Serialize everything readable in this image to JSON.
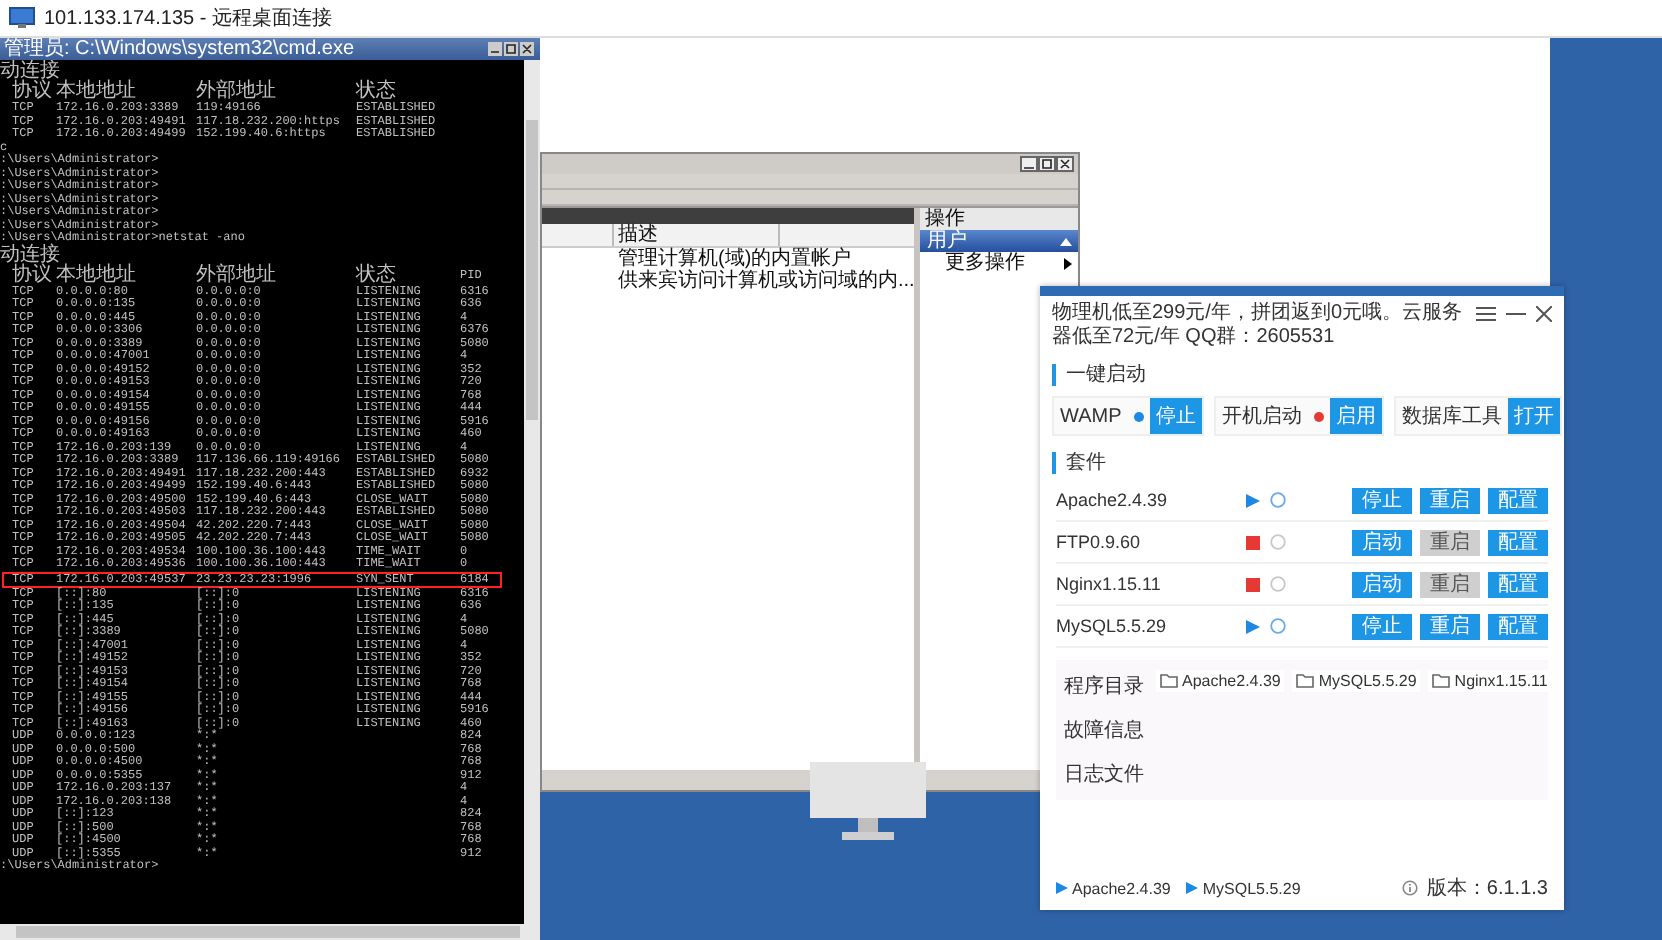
{
  "window": {
    "title": "101.133.174.135 - 远程桌面连接"
  },
  "cmd": {
    "title": "管理员: C:\\Windows\\system32\\cmd.exe",
    "lines": [
      {
        "kind": "heading",
        "text": "动连接"
      },
      {
        "kind": "header",
        "cells": [
          "协议",
          "本地地址",
          "外部地址",
          "状态"
        ]
      },
      {
        "kind": "row",
        "highlighted": false,
        "proto": "TCP",
        "local": "172.16.0.203:3389",
        "foreign": "119:49166",
        "state": "ESTABLISHED"
      },
      {
        "kind": "row",
        "highlighted": false,
        "proto": "TCP",
        "local": "172.16.0.203:49491",
        "foreign": "117.18.232.200:https",
        "state": "ESTABLISHED"
      },
      {
        "kind": "row",
        "highlighted": false,
        "proto": "TCP",
        "local": "172.16.0.203:49499",
        "foreign": "152.199.40.6:https",
        "state": "ESTABLISHED"
      },
      {
        "kind": "prompt",
        "text": "c"
      },
      {
        "kind": "prompt",
        "text": ":\\Users\\Administrator>"
      },
      {
        "kind": "prompt",
        "text": ":\\Users\\Administrator>"
      },
      {
        "kind": "prompt",
        "text": ":\\Users\\Administrator>"
      },
      {
        "kind": "prompt",
        "text": ":\\Users\\Administrator>"
      },
      {
        "kind": "prompt",
        "text": ":\\Users\\Administrator>"
      },
      {
        "kind": "prompt",
        "text": ":\\Users\\Administrator>"
      },
      {
        "kind": "prompt",
        "text": ":\\Users\\Administrator>netstat -ano"
      },
      {
        "kind": "heading",
        "text": "动连接"
      },
      {
        "kind": "header",
        "cells": [
          "协议",
          "本地地址",
          "外部地址",
          "状态",
          "PID"
        ]
      },
      {
        "kind": "row",
        "highlighted": false,
        "proto": "TCP",
        "local": "0.0.0.0:80",
        "foreign": "0.0.0.0:0",
        "state": "LISTENING",
        "pid": "6316"
      },
      {
        "kind": "row",
        "highlighted": false,
        "proto": "TCP",
        "local": "0.0.0.0:135",
        "foreign": "0.0.0.0:0",
        "state": "LISTENING",
        "pid": "636"
      },
      {
        "kind": "row",
        "highlighted": false,
        "proto": "TCP",
        "local": "0.0.0.0:445",
        "foreign": "0.0.0.0:0",
        "state": "LISTENING",
        "pid": "4"
      },
      {
        "kind": "row",
        "highlighted": false,
        "proto": "TCP",
        "local": "0.0.0.0:3306",
        "foreign": "0.0.0.0:0",
        "state": "LISTENING",
        "pid": "6376"
      },
      {
        "kind": "row",
        "highlighted": false,
        "proto": "TCP",
        "local": "0.0.0.0:3389",
        "foreign": "0.0.0.0:0",
        "state": "LISTENING",
        "pid": "5080"
      },
      {
        "kind": "row",
        "highlighted": false,
        "proto": "TCP",
        "local": "0.0.0.0:47001",
        "foreign": "0.0.0.0:0",
        "state": "LISTENING",
        "pid": "4"
      },
      {
        "kind": "row",
        "highlighted": false,
        "proto": "TCP",
        "local": "0.0.0.0:49152",
        "foreign": "0.0.0.0:0",
        "state": "LISTENING",
        "pid": "352"
      },
      {
        "kind": "row",
        "highlighted": false,
        "proto": "TCP",
        "local": "0.0.0.0:49153",
        "foreign": "0.0.0.0:0",
        "state": "LISTENING",
        "pid": "720"
      },
      {
        "kind": "row",
        "highlighted": false,
        "proto": "TCP",
        "local": "0.0.0.0:49154",
        "foreign": "0.0.0.0:0",
        "state": "LISTENING",
        "pid": "768"
      },
      {
        "kind": "row",
        "highlighted": false,
        "proto": "TCP",
        "local": "0.0.0.0:49155",
        "foreign": "0.0.0.0:0",
        "state": "LISTENING",
        "pid": "444"
      },
      {
        "kind": "row",
        "highlighted": false,
        "proto": "TCP",
        "local": "0.0.0.0:49156",
        "foreign": "0.0.0.0:0",
        "state": "LISTENING",
        "pid": "5916"
      },
      {
        "kind": "row",
        "highlighted": false,
        "proto": "TCP",
        "local": "0.0.0.0:49163",
        "foreign": "0.0.0.0:0",
        "state": "LISTENING",
        "pid": "460"
      },
      {
        "kind": "row",
        "highlighted": false,
        "proto": "TCP",
        "local": "172.16.0.203:139",
        "foreign": "0.0.0.0:0",
        "state": "LISTENING",
        "pid": "4"
      },
      {
        "kind": "row",
        "highlighted": false,
        "proto": "TCP",
        "local": "172.16.0.203:3389",
        "foreign": "117.136.66.119:49166",
        "state": "ESTABLISHED",
        "pid": "5080"
      },
      {
        "kind": "row",
        "highlighted": false,
        "proto": "TCP",
        "local": "172.16.0.203:49491",
        "foreign": "117.18.232.200:443",
        "state": "ESTABLISHED",
        "pid": "6932"
      },
      {
        "kind": "row",
        "highlighted": false,
        "proto": "TCP",
        "local": "172.16.0.203:49499",
        "foreign": "152.199.40.6:443",
        "state": "ESTABLISHED",
        "pid": "5080"
      },
      {
        "kind": "row",
        "highlighted": false,
        "proto": "TCP",
        "local": "172.16.0.203:49500",
        "foreign": "152.199.40.6:443",
        "state": "CLOSE_WAIT",
        "pid": "5080"
      },
      {
        "kind": "row",
        "highlighted": false,
        "proto": "TCP",
        "local": "172.16.0.203:49503",
        "foreign": "117.18.232.200:443",
        "state": "ESTABLISHED",
        "pid": "5080"
      },
      {
        "kind": "row",
        "highlighted": false,
        "proto": "TCP",
        "local": "172.16.0.203:49504",
        "foreign": "42.202.220.7:443",
        "state": "CLOSE_WAIT",
        "pid": "5080"
      },
      {
        "kind": "row",
        "highlighted": false,
        "proto": "TCP",
        "local": "172.16.0.203:49505",
        "foreign": "42.202.220.7:443",
        "state": "CLOSE_WAIT",
        "pid": "5080"
      },
      {
        "kind": "row",
        "highlighted": false,
        "proto": "TCP",
        "local": "172.16.0.203:49534",
        "foreign": "100.100.36.100:443",
        "state": "TIME_WAIT",
        "pid": "0"
      },
      {
        "kind": "row",
        "highlighted": false,
        "proto": "TCP",
        "local": "172.16.0.203:49536",
        "foreign": "100.100.36.100:443",
        "state": "TIME_WAIT",
        "pid": "0"
      },
      {
        "kind": "row",
        "highlighted": true,
        "proto": "TCP",
        "local": "172.16.0.203:49537",
        "foreign": "23.23.23.23:1996",
        "state": "SYN_SENT",
        "pid": "6184"
      },
      {
        "kind": "row",
        "highlighted": false,
        "proto": "TCP",
        "local": "[::]:80",
        "foreign": "[::]:0",
        "state": "LISTENING",
        "pid": "6316"
      },
      {
        "kind": "row",
        "highlighted": false,
        "proto": "TCP",
        "local": "[::]:135",
        "foreign": "[::]:0",
        "state": "LISTENING",
        "pid": "636"
      },
      {
        "kind": "row",
        "highlighted": false,
        "proto": "TCP",
        "local": "[::]:445",
        "foreign": "[::]:0",
        "state": "LISTENING",
        "pid": "4"
      },
      {
        "kind": "row",
        "highlighted": false,
        "proto": "TCP",
        "local": "[::]:3389",
        "foreign": "[::]:0",
        "state": "LISTENING",
        "pid": "5080"
      },
      {
        "kind": "row",
        "highlighted": false,
        "proto": "TCP",
        "local": "[::]:47001",
        "foreign": "[::]:0",
        "state": "LISTENING",
        "pid": "4"
      },
      {
        "kind": "row",
        "highlighted": false,
        "proto": "TCP",
        "local": "[::]:49152",
        "foreign": "[::]:0",
        "state": "LISTENING",
        "pid": "352"
      },
      {
        "kind": "row",
        "highlighted": false,
        "proto": "TCP",
        "local": "[::]:49153",
        "foreign": "[::]:0",
        "state": "LISTENING",
        "pid": "720"
      },
      {
        "kind": "row",
        "highlighted": false,
        "proto": "TCP",
        "local": "[::]:49154",
        "foreign": "[::]:0",
        "state": "LISTENING",
        "pid": "768"
      },
      {
        "kind": "row",
        "highlighted": false,
        "proto": "TCP",
        "local": "[::]:49155",
        "foreign": "[::]:0",
        "state": "LISTENING",
        "pid": "444"
      },
      {
        "kind": "row",
        "highlighted": false,
        "proto": "TCP",
        "local": "[::]:49156",
        "foreign": "[::]:0",
        "state": "LISTENING",
        "pid": "5916"
      },
      {
        "kind": "row",
        "highlighted": false,
        "proto": "TCP",
        "local": "[::]:49163",
        "foreign": "[::]:0",
        "state": "LISTENING",
        "pid": "460"
      },
      {
        "kind": "row",
        "highlighted": false,
        "proto": "UDP",
        "local": "0.0.0.0:123",
        "foreign": "*:*",
        "pid": "824"
      },
      {
        "kind": "row",
        "highlighted": false,
        "proto": "UDP",
        "local": "0.0.0.0:500",
        "foreign": "*:*",
        "pid": "768"
      },
      {
        "kind": "row",
        "highlighted": false,
        "proto": "UDP",
        "local": "0.0.0.0:4500",
        "foreign": "*:*",
        "pid": "768"
      },
      {
        "kind": "row",
        "highlighted": false,
        "proto": "UDP",
        "local": "0.0.0.0:5355",
        "foreign": "*:*",
        "pid": "912"
      },
      {
        "kind": "row",
        "highlighted": false,
        "proto": "UDP",
        "local": "172.16.0.203:137",
        "foreign": "*:*",
        "pid": "4"
      },
      {
        "kind": "row",
        "highlighted": false,
        "proto": "UDP",
        "local": "172.16.0.203:138",
        "foreign": "*:*",
        "pid": "4"
      },
      {
        "kind": "row",
        "highlighted": false,
        "proto": "UDP",
        "local": "[::]:123",
        "foreign": "*:*",
        "pid": "824"
      },
      {
        "kind": "row",
        "highlighted": false,
        "proto": "UDP",
        "local": "[::]:500",
        "foreign": "*:*",
        "pid": "768"
      },
      {
        "kind": "row",
        "highlighted": false,
        "proto": "UDP",
        "local": "[::]:4500",
        "foreign": "*:*",
        "pid": "768"
      },
      {
        "kind": "row",
        "highlighted": false,
        "proto": "UDP",
        "local": "[::]:5355",
        "foreign": "*:*",
        "pid": "912"
      },
      {
        "kind": "prompt",
        "text": ":\\Users\\Administrator>"
      }
    ]
  },
  "console": {
    "column_header": "描述",
    "rows": [
      "管理计算机(域)的内置帐户",
      "供来宾访问计算机或访问域的内..."
    ],
    "actions_title": "操作",
    "action_group": "用户",
    "actions": [
      "更多操作"
    ]
  },
  "app": {
    "notice": "物理机低至299元/年，拼团返到0元哦。云服务器低至72元/年  QQ群：2605531",
    "start_section": "一键启动",
    "quick": [
      {
        "label": "WAMP",
        "color": "#1e88e5",
        "button": "停止"
      },
      {
        "label": "开机启动",
        "color": "#e53935",
        "button": "启用"
      },
      {
        "label": "数据库工具",
        "button": "打开"
      }
    ],
    "suite_section": "套件",
    "services": [
      {
        "name": "Apache2.4.39",
        "running": true,
        "buttons": [
          {
            "label": "停止",
            "disabled": false
          },
          {
            "label": "重启",
            "disabled": false
          },
          {
            "label": "配置",
            "disabled": false
          }
        ]
      },
      {
        "name": "FTP0.9.60",
        "running": false,
        "buttons": [
          {
            "label": "启动",
            "disabled": false
          },
          {
            "label": "重启",
            "disabled": true
          },
          {
            "label": "配置",
            "disabled": false
          }
        ]
      },
      {
        "name": "Nginx1.15.11",
        "running": false,
        "buttons": [
          {
            "label": "启动",
            "disabled": false
          },
          {
            "label": "重启",
            "disabled": true
          },
          {
            "label": "配置",
            "disabled": false
          }
        ]
      },
      {
        "name": "MySQL5.5.29",
        "running": true,
        "buttons": [
          {
            "label": "停止",
            "disabled": false
          },
          {
            "label": "重启",
            "disabled": false
          },
          {
            "label": "配置",
            "disabled": false
          }
        ]
      }
    ],
    "path_labels": [
      "程序目录",
      "故障信息",
      "日志文件"
    ],
    "folders": [
      "Apache2.4.39",
      "MySQL5.5.29",
      "Nginx1.15.11"
    ],
    "footer_running": [
      "Apache2.4.39",
      "MySQL5.5.29"
    ],
    "version": "版本：6.1.1.3"
  }
}
